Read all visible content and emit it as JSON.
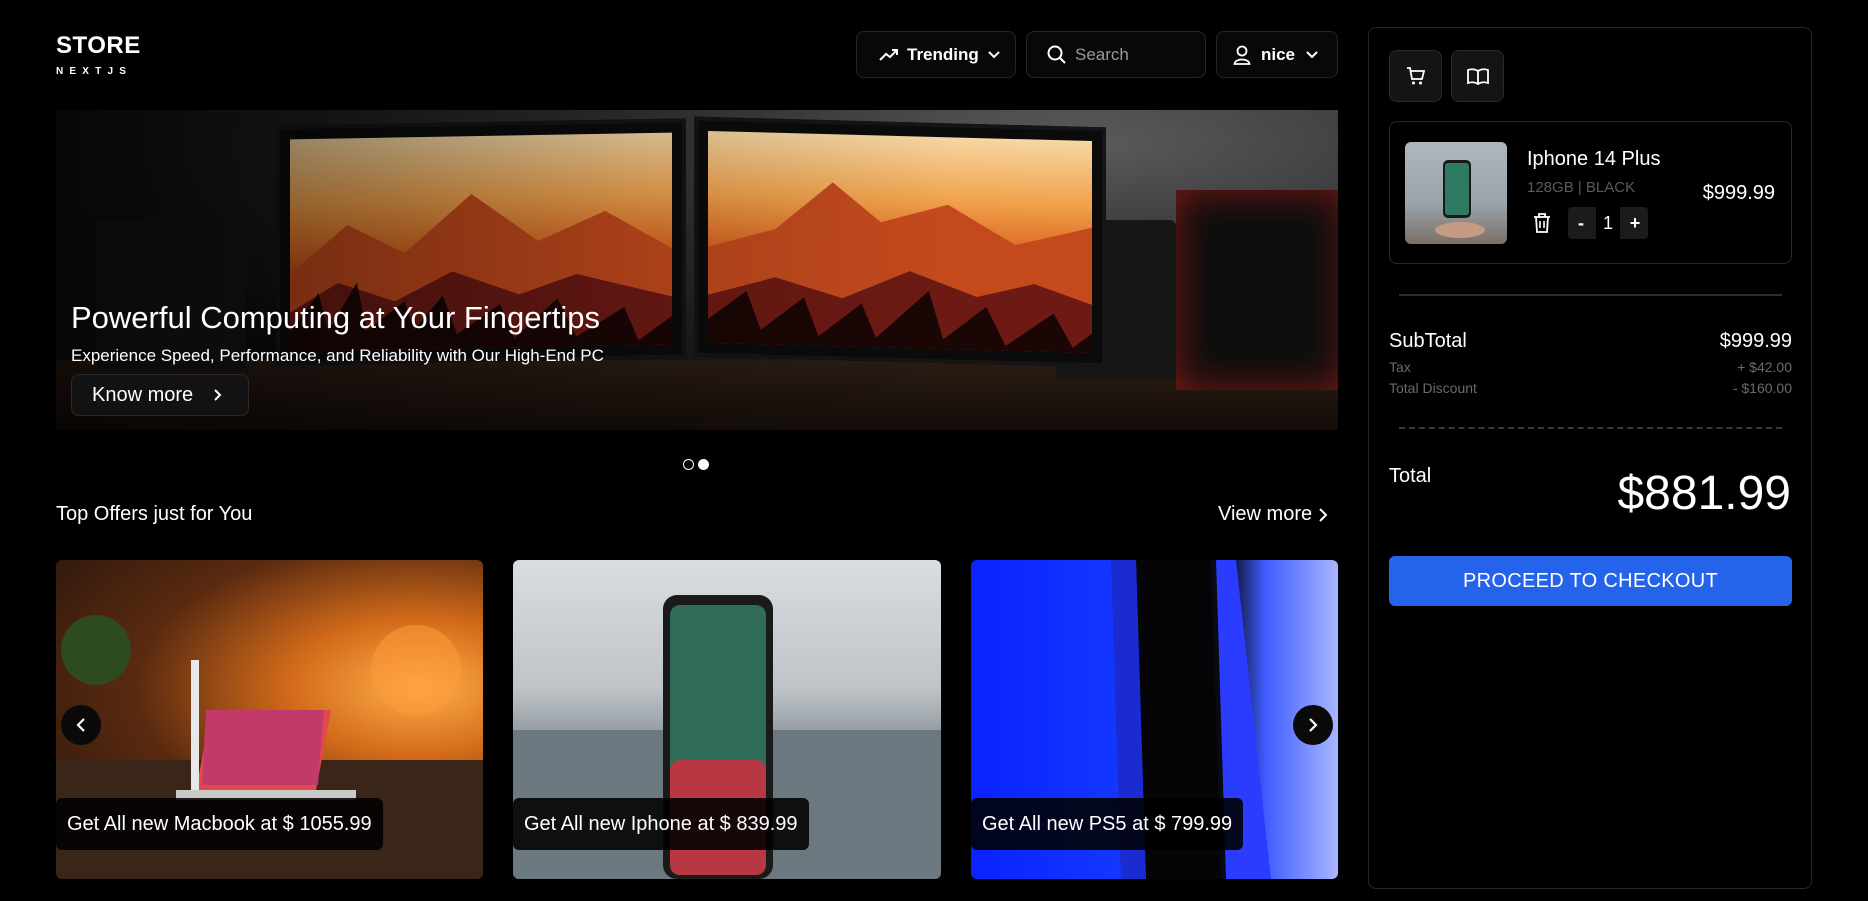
{
  "logo": {
    "main": "STORE",
    "sub": "NEXTJS"
  },
  "header": {
    "trending_label": "Trending",
    "search_placeholder": "Search",
    "user_label": "nice"
  },
  "hero": {
    "title": "Powerful Computing at Your Fingertips",
    "subtitle": "Experience Speed, Performance, and Reliability with Our High-End PC",
    "button_label": "Know more",
    "slide_count": 2,
    "active_slide": 2
  },
  "offers": {
    "title": "Top Offers just for You",
    "view_more": "View more",
    "cards": [
      {
        "label": "Get All new Macbook at $ 1055.99"
      },
      {
        "label": "Get All new Iphone at $ 839.99"
      },
      {
        "label": "Get All new PS5 at $ 799.99"
      }
    ]
  },
  "cart": {
    "tabs": [
      "cart-icon",
      "book-open-icon"
    ],
    "item": {
      "name": "Iphone 14 Plus",
      "meta": "128GB | BLACK",
      "price": "$999.99",
      "qty_minus": "-",
      "quantity": "1",
      "qty_plus": "+"
    },
    "subtotal_label": "SubTotal",
    "subtotal_value": "$999.99",
    "tax_label": "Tax",
    "tax_value": "+ $42.00",
    "discount_label": "Total Discount",
    "discount_value": "- $160.00",
    "total_label": "Total",
    "total_value": "$881.99",
    "checkout_label": "PROCEED TO CHECKOUT"
  },
  "colors": {
    "accent": "#2563eb",
    "background": "#000000",
    "border": "#262626"
  }
}
